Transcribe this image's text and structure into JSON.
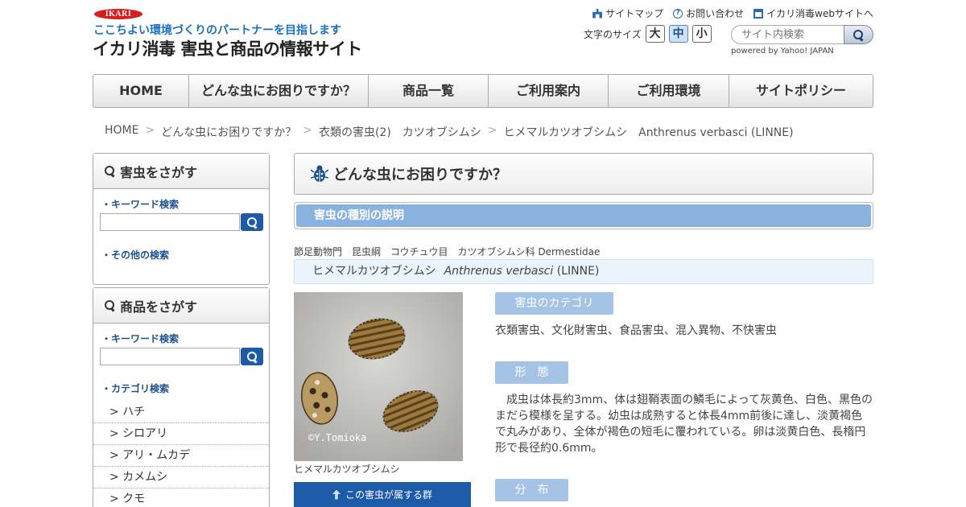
{
  "header": {
    "logo": "IKARI",
    "tagline": "ここちよい環境づくりのパートナーを目指します",
    "title": "イカリ消毒 害虫と商品の情報サイト",
    "util_links": [
      "サイトマップ",
      "お問い合わせ",
      "イカリ消毒webサイトへ"
    ],
    "fontsize_label": "文字のサイズ",
    "fontsize_options": [
      "大",
      "中",
      "小"
    ],
    "fontsize_selected": "中",
    "search_placeholder": "サイト内検索",
    "powered_by": "powered by Yahoo! JAPAN"
  },
  "nav": {
    "items": [
      "HOME",
      "どんな虫にお困りですか？",
      "商品一覧",
      "ご利用案内",
      "ご利用環境",
      "サイトポリシー"
    ]
  },
  "breadcrumb": {
    "items": [
      "HOME",
      "どんな虫にお困りですか？",
      "衣類の害虫(2)　カツオブシムシ",
      "ヒメマルカツオブシムシ　Anthrenus verbasci (LINNE)"
    ],
    "separator": ">"
  },
  "sidebar": {
    "pest_box": {
      "title": "害虫をさがす",
      "keyword_label": "・キーワード検索",
      "other_label": "・その他の検索"
    },
    "product_box": {
      "title": "商品をさがす",
      "keyword_label": "・キーワード検索",
      "category_label": "・カテゴリ検索",
      "categories": [
        "> ハチ",
        "> シロアリ",
        "> アリ・ムカデ",
        "> カメムシ",
        "> クモ"
      ]
    }
  },
  "main": {
    "heading": "どんな虫にお困りですか？",
    "subheading": "害虫の種別の説明",
    "taxonomy": "節足動物門　昆虫綱　コウチュウ目　カツオブシムシ科 Dermestidae",
    "species_jp": "ヒメマルカツオブシムシ",
    "species_sci": "Anthrenus verbasci",
    "species_author": "(LINNE)",
    "photo_credit": "©Y.Tomioka",
    "photo_caption": "ヒメマルカツオブシムシ",
    "group_button": "この害虫が属する群",
    "sections": {
      "category_tag": "害虫のカテゴリ",
      "category_text": "衣類害虫、文化財害虫、食品害虫、混入異物、不快害虫",
      "form_tag": "形　態",
      "form_text": "　成虫は体長約3mm、体は翅鞘表面の鱗毛によって灰黄色、白色、黒色のまだら模様を呈する。幼虫は成熟すると体長4mm前後に達し、淡黄褐色で丸みがあり、全体が褐色の短毛に覆われている。卵は淡黄白色、長楕円形で長径約0.6mm。",
      "distribution_tag": "分　布"
    }
  },
  "colors": {
    "brand_red": "#d81d1d",
    "tagline_blue": "#1a6fc1",
    "accent_blue": "#1d5aa8",
    "band_blue": "#8ab2de",
    "tag_blue": "#a5c3e4"
  }
}
